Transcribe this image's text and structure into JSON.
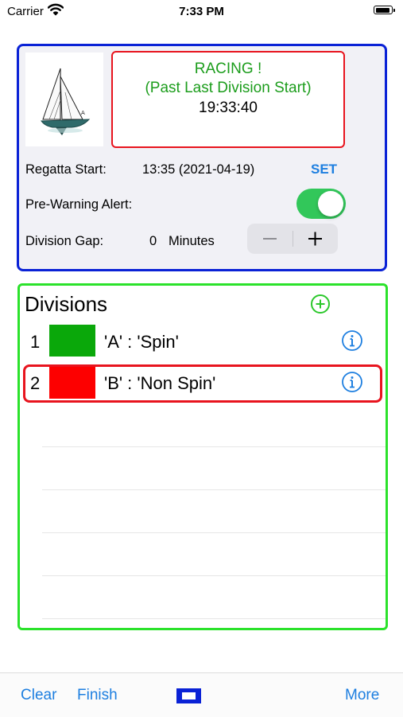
{
  "status_bar": {
    "carrier": "Carrier",
    "time": "7:33 PM",
    "battery_level": 0.95
  },
  "top_panel": {
    "status_line1": "RACING !",
    "status_line2": "(Past Last Division Start)",
    "status_time": "19:33:40",
    "regatta_start_label": "Regatta Start:",
    "regatta_start_value": "13:35 (2021-04-19)",
    "set_label": "SET",
    "prewarning_label": "Pre-Warning Alert:",
    "prewarning_on": true,
    "division_gap_label": "Division Gap:",
    "division_gap_value": "0",
    "division_gap_unit": "Minutes"
  },
  "divisions": {
    "title": "Divisions",
    "items": [
      {
        "number": "1",
        "label": "'A' : 'Spin'",
        "color": "#0aa80a"
      },
      {
        "number": "2",
        "label": "'B' : 'Non Spin'",
        "color": "#fd0000"
      }
    ]
  },
  "tab_bar": {
    "clear": "Clear",
    "finish": "Finish",
    "more": "More"
  },
  "colors": {
    "accent": "#1e7fe0",
    "panel_border": "#0a22d6",
    "divisions_border": "#2be22b",
    "alert_red": "#e8141e",
    "racing_green": "#1c9d1c",
    "toggle_on": "#32c75a"
  }
}
